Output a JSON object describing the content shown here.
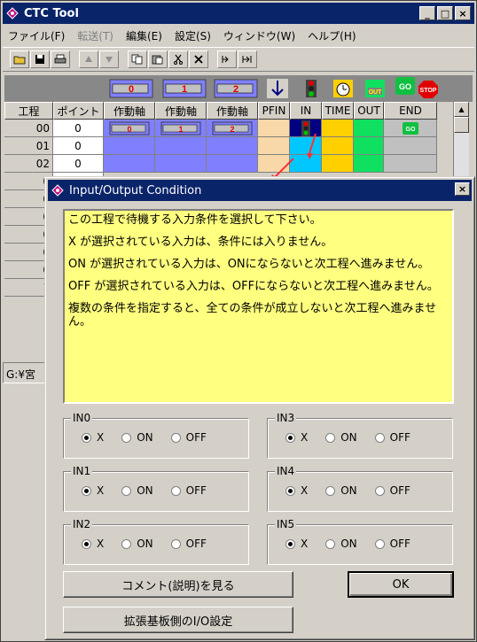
{
  "main": {
    "title": "CTC Tool",
    "window_buttons": [
      "_",
      "□",
      "×"
    ],
    "menu": [
      {
        "label": "ファイル(F)",
        "enabled": true
      },
      {
        "label": "転送(T)",
        "enabled": false
      },
      {
        "label": "編集(E)",
        "enabled": true
      },
      {
        "label": "設定(S)",
        "enabled": true
      },
      {
        "label": "ウィンドウ(W)",
        "enabled": true
      },
      {
        "label": "ヘルプ(H)",
        "enabled": true
      }
    ],
    "action_buttons": [
      "0",
      "1",
      "2"
    ],
    "action_text": {
      "go": "GO",
      "stop": "STOP",
      "out": "OUT"
    },
    "grid": {
      "headers": [
        "工程",
        "ポイント",
        "作動軸",
        "作動軸",
        "作動軸",
        "PFIN",
        "IN",
        "TIME",
        "OUT",
        "END"
      ],
      "rows": [
        {
          "step": "00",
          "point": "0"
        },
        {
          "step": "01",
          "point": "0"
        },
        {
          "step": "02",
          "point": "0"
        },
        {
          "step": "0",
          "point": ""
        },
        {
          "step": "0",
          "point": ""
        },
        {
          "step": "0",
          "point": ""
        },
        {
          "step": "0",
          "point": ""
        },
        {
          "step": "0",
          "point": ""
        },
        {
          "step": "0",
          "point": ""
        },
        {
          "step": "1",
          "point": ""
        }
      ]
    },
    "status": "G:¥宮"
  },
  "dialog": {
    "title": "Input/Output Condition",
    "close": "×",
    "info": [
      "この工程で待機する入力条件を選択して下さい。",
      "X が選択されている入力は、条件には入りません。",
      "ON が選択されている入力は、ONにならないと次工程へ進みません。",
      "OFF が選択されている入力は、OFFにならないと次工程へ進みません。",
      "複数の条件を指定すると、全ての条件が成立しないと次工程へ進みません。"
    ],
    "options": [
      "X",
      "ON",
      "OFF"
    ],
    "groups": [
      {
        "label": "IN0",
        "selected": "X"
      },
      {
        "label": "IN1",
        "selected": "X"
      },
      {
        "label": "IN2",
        "selected": "X"
      },
      {
        "label": "IN3",
        "selected": "X"
      },
      {
        "label": "IN4",
        "selected": "X"
      },
      {
        "label": "IN5",
        "selected": "X"
      }
    ],
    "buttons": {
      "comment": "コメント(説明)を見る",
      "ok": "OK",
      "io_setting": "拡張基板側のI/O設定"
    }
  }
}
